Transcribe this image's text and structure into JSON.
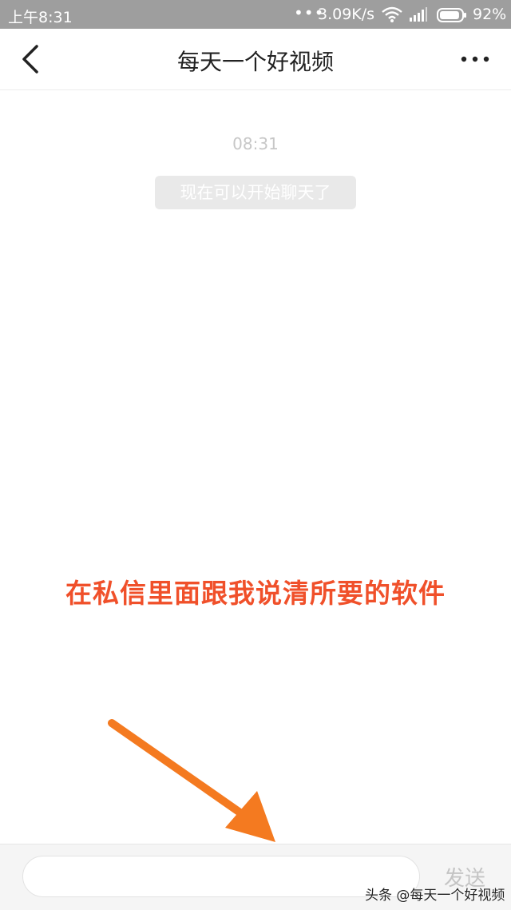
{
  "status_bar": {
    "time": "上午8:31",
    "dots": "•••",
    "network_speed": "3.09K/s",
    "battery_percent": "92%",
    "battery_level": 0.92,
    "icons": [
      "wifi-icon",
      "signal-icon",
      "battery-icon"
    ]
  },
  "header": {
    "title": "每天一个好视频",
    "back_icon": "chevron-left-icon",
    "more_icon": "more-dots-icon"
  },
  "chat": {
    "timestamp": "08:31",
    "system_message": "现在可以开始聊天了"
  },
  "annotation": {
    "text": "在私信里面跟我说清所要的软件",
    "color": "#f0502a",
    "arrow_color": "#f47a20"
  },
  "input_bar": {
    "placeholder": "",
    "send_label": "发送"
  },
  "watermark": {
    "text": "头条 @每天一个好视频"
  }
}
